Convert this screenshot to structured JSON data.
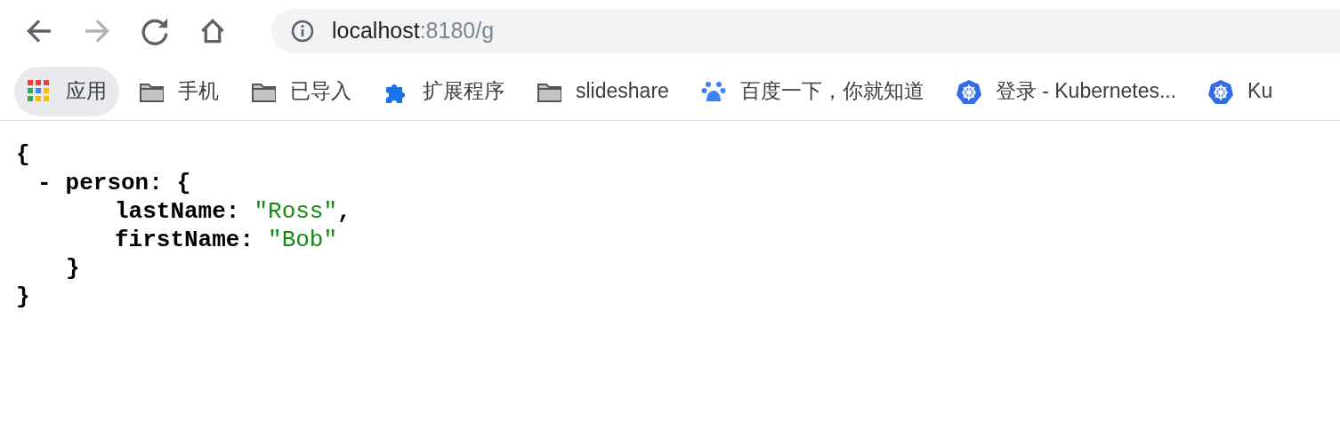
{
  "toolbar": {
    "buttons": [
      {
        "kind": "back",
        "disabled": false
      },
      {
        "kind": "forward",
        "disabled": true
      },
      {
        "kind": "reload",
        "disabled": false
      },
      {
        "kind": "home",
        "disabled": false
      }
    ]
  },
  "address_bar": {
    "host": "localhost",
    "path": ":8180/g"
  },
  "bookmarks": [
    {
      "kind": "apps",
      "label": "应用",
      "selected": true
    },
    {
      "kind": "folder",
      "label": "手机",
      "selected": false
    },
    {
      "kind": "folder",
      "label": "已导入",
      "selected": false
    },
    {
      "kind": "extension",
      "label": "扩展程序",
      "selected": false
    },
    {
      "kind": "folder",
      "label": "slideshare",
      "selected": false
    },
    {
      "kind": "paw",
      "label": "百度一下，你就知道",
      "selected": false
    },
    {
      "kind": "wheel",
      "label": "登录 - Kubernetes...",
      "selected": false
    },
    {
      "kind": "wheel",
      "label": "Ku",
      "selected": false
    }
  ],
  "json_view": {
    "open": "{",
    "members": [
      {
        "toggle": "-",
        "key": "person:",
        "open": "{",
        "children": [
          {
            "key": "lastName:",
            "value": "\"Ross\"",
            "comma": ","
          },
          {
            "key": "firstName:",
            "value": "\"Bob\""
          }
        ],
        "close": "}"
      }
    ],
    "close": "}"
  }
}
